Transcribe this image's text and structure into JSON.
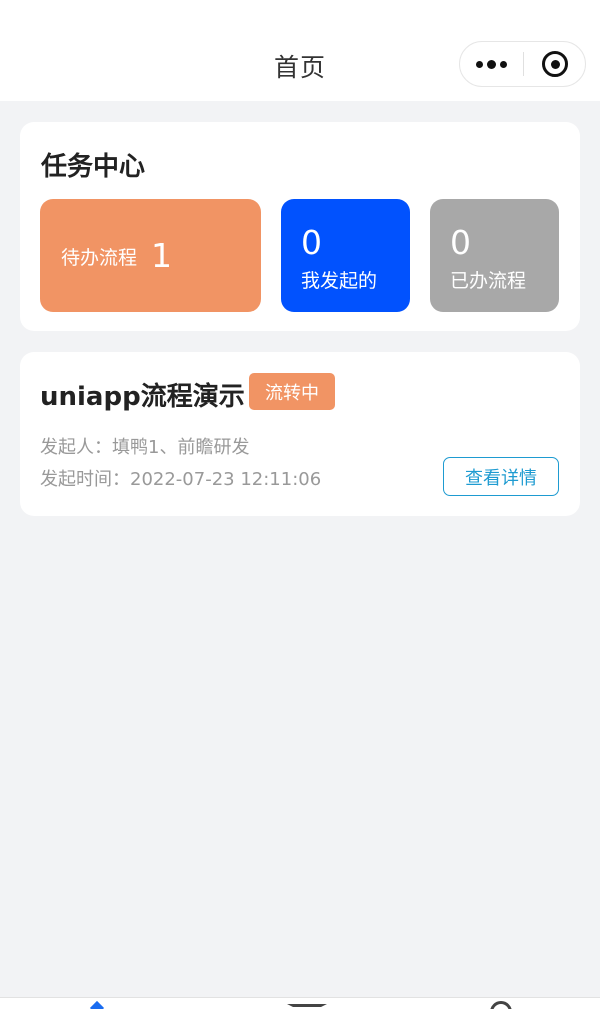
{
  "navbar": {
    "title": "首页",
    "more_icon": "more-dots-icon",
    "close_icon": "target-circle-icon"
  },
  "task_center": {
    "title": "任务中心",
    "todo": {
      "label": "待办流程",
      "count": "1",
      "color": "#f19464"
    },
    "initiated": {
      "count": "0",
      "label": "我发起的",
      "color": "#0152fe"
    },
    "done": {
      "count": "0",
      "label": "已办流程",
      "color": "#a8a8a8"
    }
  },
  "process": {
    "title": "uniapp流程演示",
    "status": "流转中",
    "initiator": "发起人：填鸭1、前瞻研发",
    "time": "发起时间：2022-07-23 12:11:06",
    "detail_button": "查看详情"
  },
  "tabbar": {
    "icons": [
      "home-icon",
      "grid-icon",
      "user-icon"
    ]
  }
}
